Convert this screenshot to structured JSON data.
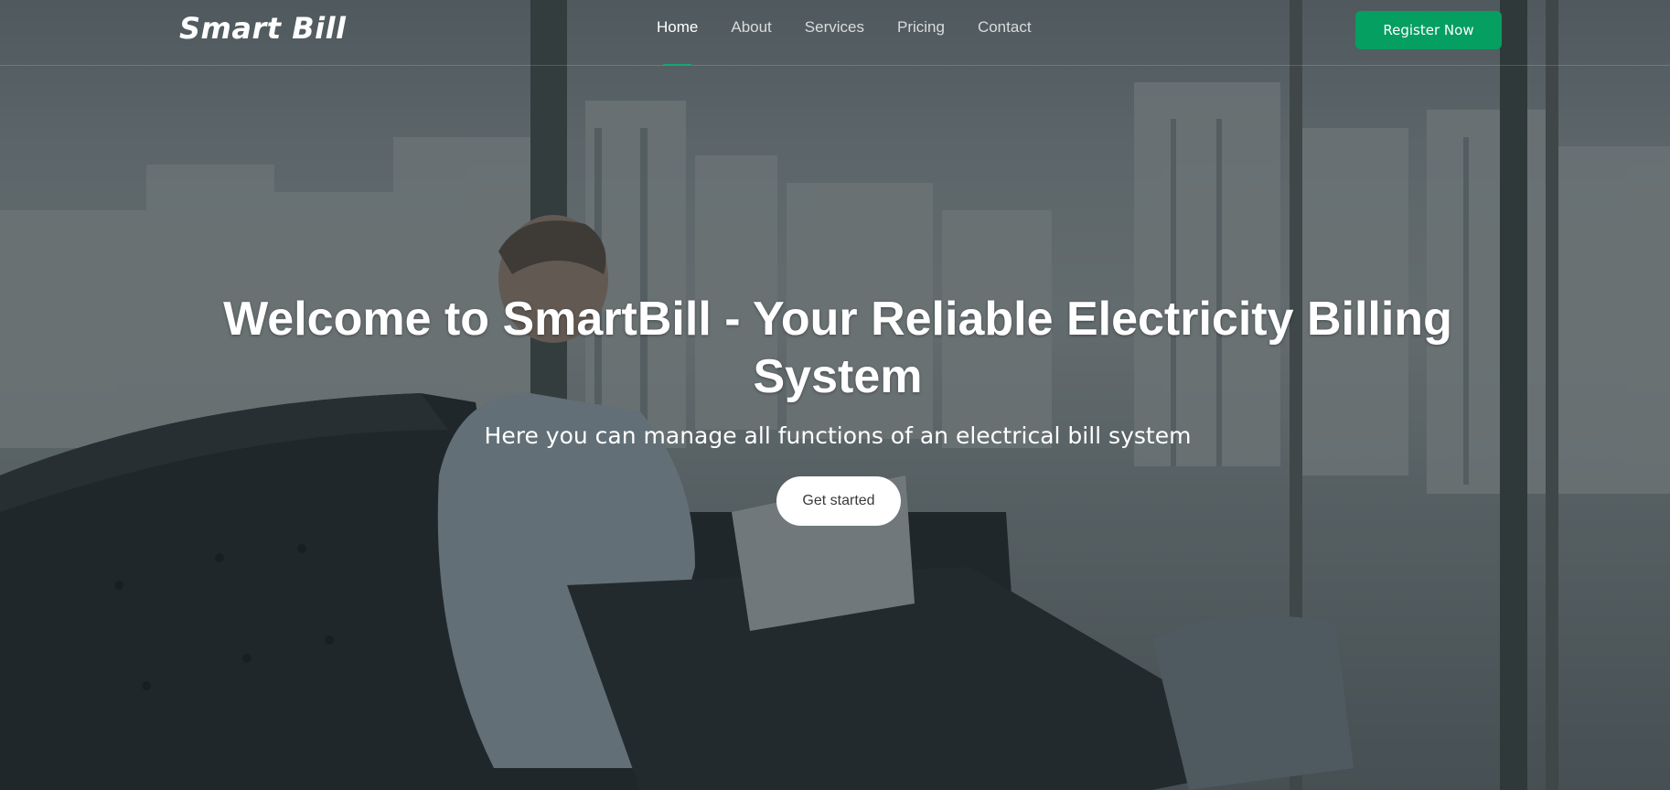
{
  "brand": {
    "logo_text": "Smart Bill"
  },
  "nav": {
    "items": [
      {
        "label": "Home",
        "active": true
      },
      {
        "label": "About",
        "active": false
      },
      {
        "label": "Services",
        "active": false
      },
      {
        "label": "Pricing",
        "active": false
      },
      {
        "label": "Contact",
        "active": false
      }
    ],
    "register_label": "Register Now"
  },
  "hero": {
    "title": "Welcome to SmartBill - Your Reliable Electricity Billing System",
    "subtitle": "Here you can manage all functions of an electrical bill system",
    "cta_label": "Get started"
  },
  "colors": {
    "accent": "#049f61",
    "active_underline": "#17a672",
    "overlay": "rgba(22,28,32,0.52)"
  }
}
